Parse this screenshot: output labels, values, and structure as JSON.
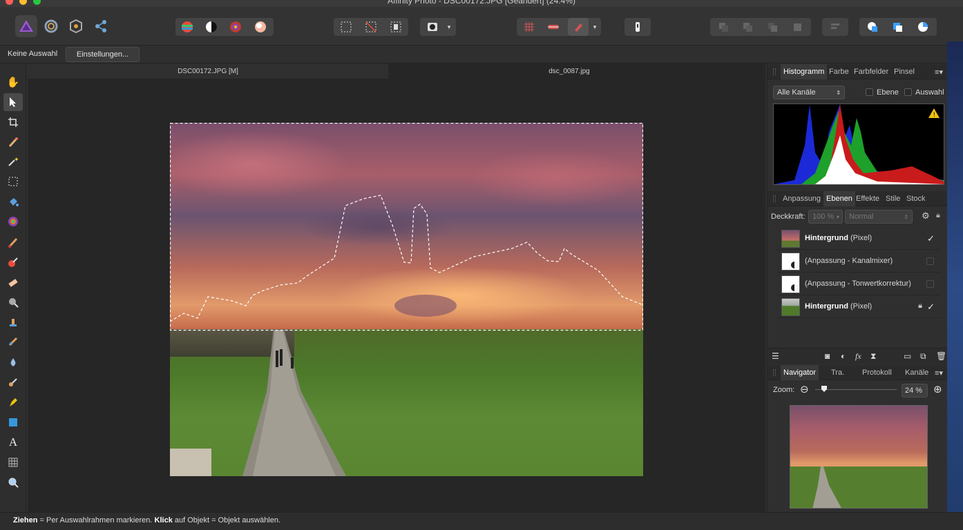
{
  "window": {
    "title": "Affinity Photo - DSC00172.JPG [Geändert] (24.4%)"
  },
  "traffic_lights": {
    "close": "#ff5f57",
    "minimize": "#febc2e",
    "zoom": "#28c840"
  },
  "context": {
    "selection_label": "Keine Auswahl",
    "settings_button": "Einstellungen..."
  },
  "document_tabs": [
    {
      "label": "DSC00172.JPG [M]"
    },
    {
      "label": "dsc_0087.jpg"
    }
  ],
  "histogram_panel": {
    "tabs": [
      "Histogramm",
      "Farbe",
      "Farbfelder",
      "Pinsel"
    ],
    "channel_select": "Alle Kanäle",
    "layer_checkbox": "Ebene",
    "selection_checkbox": "Auswahl"
  },
  "layers_panel": {
    "tabs": [
      "Anpassung",
      "Ebenen",
      "Effekte",
      "Stile",
      "Stock"
    ],
    "opacity_label": "Deckkraft:",
    "opacity_value": "100 %",
    "blend_mode": "Normal",
    "layers": [
      {
        "name": "Hintergrund",
        "type": "(Pixel)",
        "visible": true
      },
      {
        "name": "",
        "type": "(Anpassung - Kanalmixer)",
        "visible": false
      },
      {
        "name": "",
        "type": "(Anpassung - Tonwertkorrektur)",
        "visible": false
      },
      {
        "name": "Hintergrund",
        "type": "(Pixel)",
        "visible": true,
        "locked": true
      }
    ]
  },
  "navigator_panel": {
    "tabs": [
      "Navigator",
      "Tra.",
      "Protokoll",
      "Kanäle"
    ],
    "zoom_label": "Zoom:",
    "zoom_value": "24 %"
  },
  "statusbar": {
    "drag_key": "Ziehen",
    "drag_text": " = Per Auswahlrahmen markieren. ",
    "click_key": "Klick",
    "click_text": " auf Objekt = Objekt auswählen."
  }
}
